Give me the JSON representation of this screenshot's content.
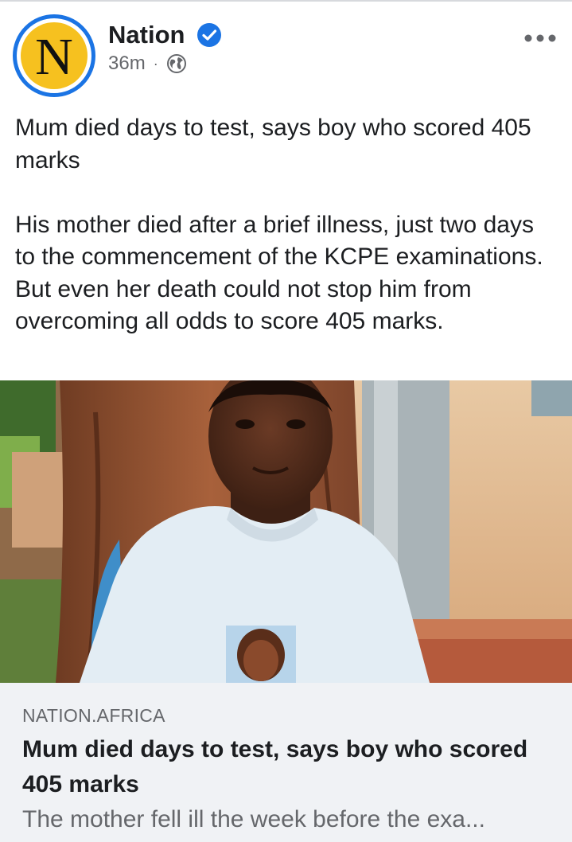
{
  "post": {
    "page_name": "Nation",
    "avatar_letter": "N",
    "time": "36m",
    "separator": "·",
    "text": "Mum died days to test, says boy who scored 405 marks\n\nHis mother died after a brief illness, just two days to the commencement of the KCPE examinations. But even her death could not stop him from overcoming all odds to score 405 marks."
  },
  "icons": {
    "verified": "verified-badge-icon",
    "privacy": "globe-icon",
    "more": "more-options-icon"
  },
  "link_preview": {
    "domain": "NATION.AFRICA",
    "title": "Mum died days to test, says boy who scored 405 marks",
    "description": "The mother fell ill the week before the exa..."
  },
  "colors": {
    "accent": "#1b74e4",
    "avatar_bg": "#f6c11f",
    "secondary_text": "#65676b",
    "preview_bg": "#f0f2f5"
  }
}
